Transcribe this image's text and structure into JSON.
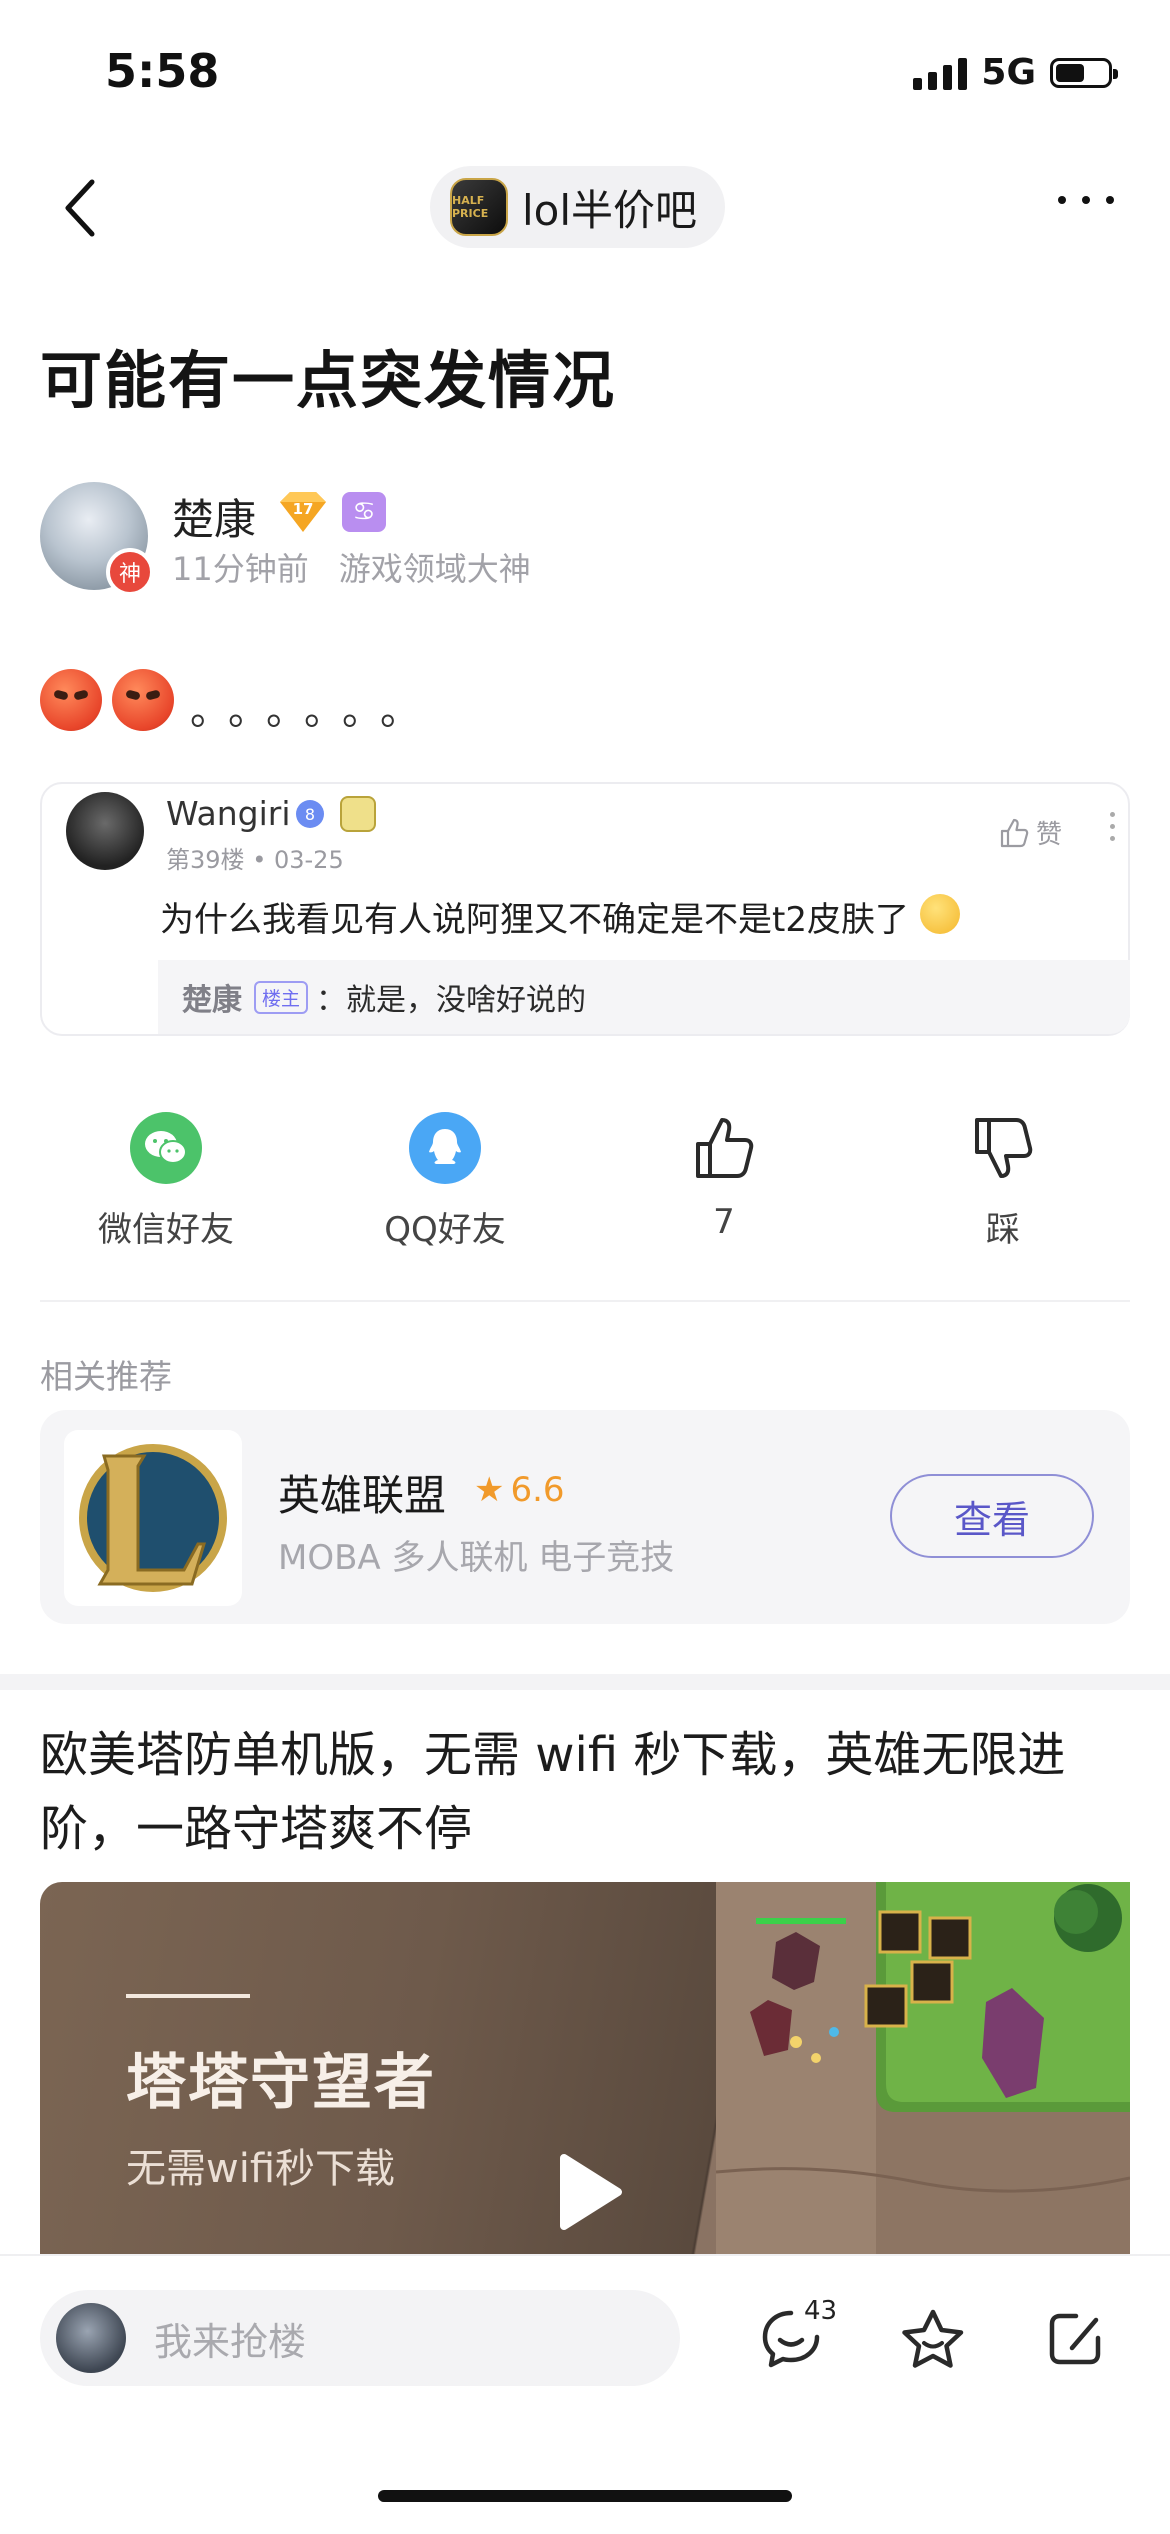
{
  "status_bar": {
    "time": "5:58",
    "network": "5G"
  },
  "nav": {
    "forum_name": "lol半价吧",
    "forum_logo_text": "HALF PRICE"
  },
  "post": {
    "title": "可能有一点突发情况",
    "author": {
      "name": "楚康",
      "level": "17",
      "zodiac_symbol": "♋",
      "avatar_badge": "神"
    },
    "time_ago": "11分钟前",
    "author_tag": "游戏领域大神",
    "body_dots": "。。。。。。"
  },
  "quoted_comment": {
    "user": "Wangiri",
    "level_badge": "8",
    "floor": "第39楼",
    "date": "03-25",
    "like_label": "赞",
    "text": "为什么我看见有人说阿狸又不确定是不是t2皮肤了",
    "reply": {
      "author": "楚康",
      "tag": "楼主",
      "separator": "：",
      "text": "就是，没啥好说的"
    }
  },
  "share_row": [
    {
      "label": "微信好友",
      "icon": "wechat-icon",
      "color": "#4cc36a"
    },
    {
      "label": "QQ好友",
      "icon": "qq-icon",
      "color": "#4aa7f5"
    },
    {
      "label": "7",
      "icon": "thumbs-up-icon"
    },
    {
      "label": "踩",
      "icon": "thumbs-down-icon"
    }
  ],
  "recommend": {
    "heading": "相关推荐",
    "app": {
      "name": "英雄联盟",
      "rating": "6.6",
      "tags": "MOBA 多人联机 电子竞技",
      "button": "查看"
    }
  },
  "ad": {
    "text": "欧美塔防单机版，无需 wifi 秒下载，英雄无限进阶，一路守塔爽不停",
    "game_title": "塔塔守望者",
    "game_subtitle": "无需wifi秒下载"
  },
  "bottom_bar": {
    "placeholder": "我来抢楼",
    "comment_count": "43"
  }
}
